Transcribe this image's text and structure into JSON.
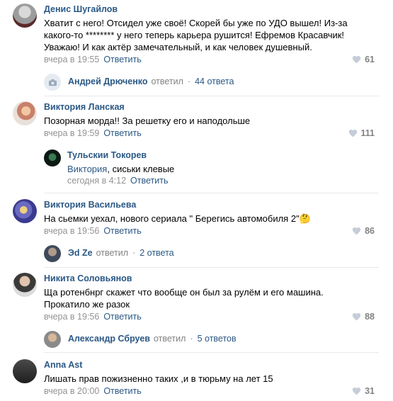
{
  "comments": [
    {
      "name": "Денис Шугайлов",
      "lines": [
        "Хватит с него! Отсидел уже своё! Скорей бы уже по УДО вышел! Из-за",
        "какого-то ******** у него теперь карьера рушится! Ефремов Красавчик!",
        "Уважаю! И как актёр замечательный, и как человек душевный."
      ],
      "time": "вчера в 19:55",
      "reply_label": "Ответить",
      "likes": "61",
      "thread": {
        "name": "Андрей Дрюченко",
        "action": "ответил",
        "count": "44 ответа"
      }
    },
    {
      "name": "Виктория Ланская",
      "lines": [
        "Позорная морда!! За решетку его и наподольше"
      ],
      "time": "вчера в 19:59",
      "reply_label": "Ответить",
      "likes": "111",
      "reply": {
        "name": "Тульскии Токорев",
        "addressee": "Виктория",
        "text": ", сиськи клевые",
        "time": "сегодня в 4:12",
        "reply_label": "Ответить"
      }
    },
    {
      "name": "Виктория Васильева",
      "lines": [
        "На сьемки уехал, нового сериала \" Берегись автомобиля 2\""
      ],
      "emoji": "🤔",
      "time": "вчера в 19:56",
      "reply_label": "Ответить",
      "likes": "86",
      "thread": {
        "name": "Эd Ze",
        "action": "ответил",
        "count": "2 ответа"
      }
    },
    {
      "name": "Никита Соловьянов",
      "lines": [
        "Ща ротенбнрг скажет что вообще он был за рулём и его машина.",
        "Прокатило же разок"
      ],
      "time": "вчера в 19:56",
      "reply_label": "Ответить",
      "likes": "88",
      "thread": {
        "name": "Александр Сбруев",
        "action": "ответил",
        "count": "5 ответов"
      }
    },
    {
      "name": "Anna Ast",
      "lines": [
        "Лишать прав пожизненно таких ,и в тюрьму на лет 15"
      ],
      "time": "вчера в 20:00",
      "reply_label": "Ответить",
      "likes": "31"
    }
  ],
  "colors": {
    "link": "#2a5885",
    "meta": "#939393",
    "divider": "#e7e8ec"
  }
}
